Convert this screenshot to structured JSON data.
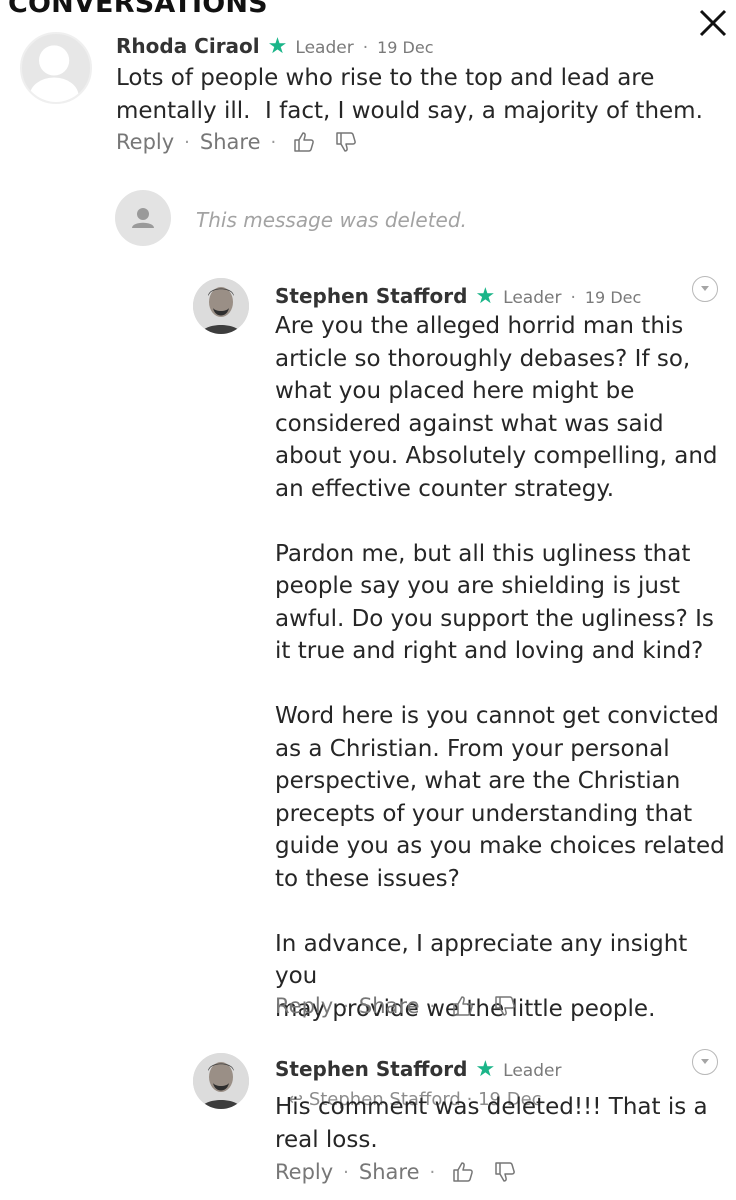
{
  "header": {
    "title": "CONVERSATIONS",
    "close_icon": "close-icon"
  },
  "comments": [
    {
      "author": "Rhoda Ciraol",
      "badge": "Leader",
      "date": "19 Dec",
      "text": "Lots of people who rise to the top and lead are\nmentally ill.  I fact, I would say, a majority of them."
    },
    {
      "deleted_text": "This message was deleted."
    },
    {
      "author": "Stephen Stafford",
      "badge": "Leader",
      "date": "19 Dec",
      "text": "Are you the alleged horrid man this\narticle so thoroughly debases? If so,\nwhat you placed here might be\nconsidered against what was said\nabout you. Absolutely compelling, and\nan effective counter strategy.\n\nPardon me, but all this ugliness that\npeople say you are shielding is just\nawful. Do you support the ugliness? Is\nit true and right and loving and kind?\n\nWord here is you cannot get convicted\nas a Christian. From your personal\nperspective, what are the Christian\nprecepts of your understanding that\nguide you as you make choices related\nto these issues?\n\nIn advance, I appreciate any insight you\nmay provide we the little people."
    },
    {
      "author": "Stephen Stafford",
      "badge": "Leader",
      "reply_to": "Stephen Stafford",
      "date": "19 Dec",
      "text": "His comment was deleted!!! That is a\nreal loss."
    }
  ],
  "actions": {
    "reply": "Reply",
    "share": "Share",
    "separator": "·"
  },
  "colors": {
    "star": "#1bb589",
    "text": "#262626",
    "muted": "#777777"
  }
}
